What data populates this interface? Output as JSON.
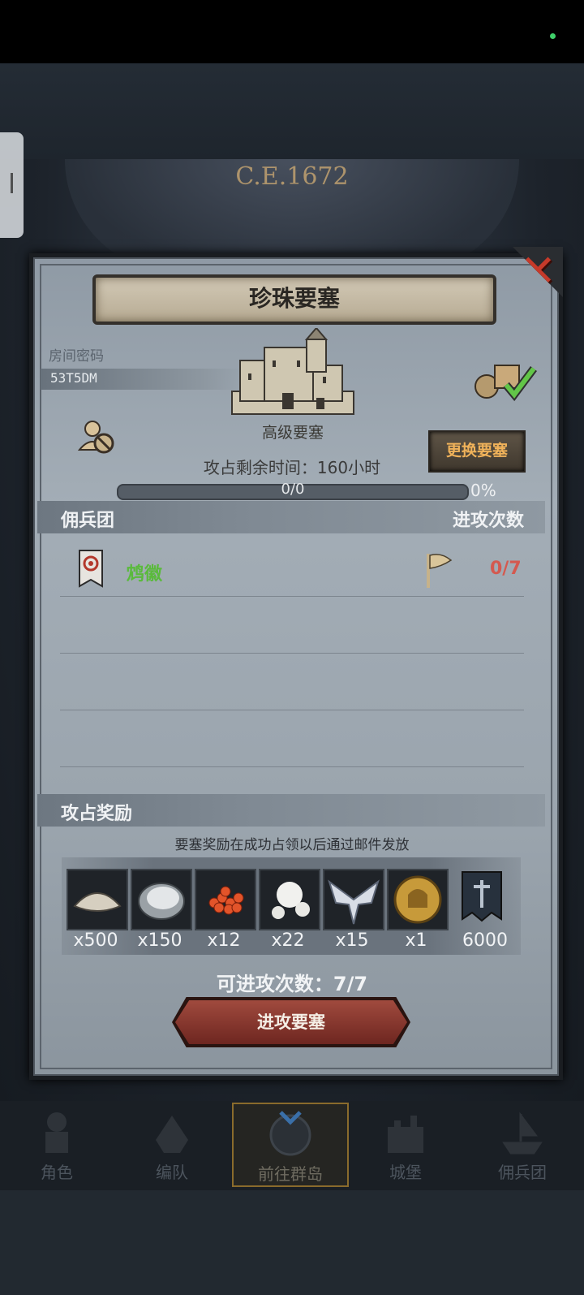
{
  "era": "C.E.1672",
  "dialog": {
    "title": "珍珠要塞",
    "room_label": "房间密码",
    "room_code": "53T5DM",
    "fort_type": "高级要塞",
    "change_button": "更换要塞",
    "time_label": "攻占剩余时间：160小时",
    "progress": {
      "text": "0/0",
      "percent_label": "0%",
      "fraction": 0
    },
    "mercenary_header": "佣兵团",
    "attack_count_header": "进攻次数",
    "guilds": [
      {
        "name": "鸩徽",
        "attacks": "0/7"
      }
    ],
    "reward_header": "攻占奖励",
    "reward_note": "要塞奖励在成功占领以后通过邮件发放",
    "rewards": [
      {
        "icon": "sand-pile-icon",
        "qty": "x500"
      },
      {
        "icon": "oyster-icon",
        "qty": "x150"
      },
      {
        "icon": "roe-icon",
        "qty": "x12"
      },
      {
        "icon": "pearls-icon",
        "qty": "x22"
      },
      {
        "icon": "winged-emblem-icon",
        "qty": "x15"
      },
      {
        "icon": "knight-coin-icon",
        "qty": "x1"
      },
      {
        "icon": "guild-banner-icon",
        "qty": "6000"
      }
    ],
    "attempts_label": "可进攻次数：7/7",
    "attack_button": "进攻要塞"
  },
  "bottom_nav": [
    {
      "label": "角色",
      "icon": "knight-icon"
    },
    {
      "label": "编队",
      "icon": "formation-icon"
    },
    {
      "label": "前往群岛",
      "icon": "compass-icon",
      "active": true
    },
    {
      "label": "城堡",
      "icon": "castle-icon"
    },
    {
      "label": "佣兵团",
      "icon": "ship-icon"
    }
  ],
  "colors": {
    "guild_name": "#5aba3c",
    "attack_count": "#d4594f",
    "change_button_text": "#f0b25a",
    "close": "#c63a2a"
  }
}
